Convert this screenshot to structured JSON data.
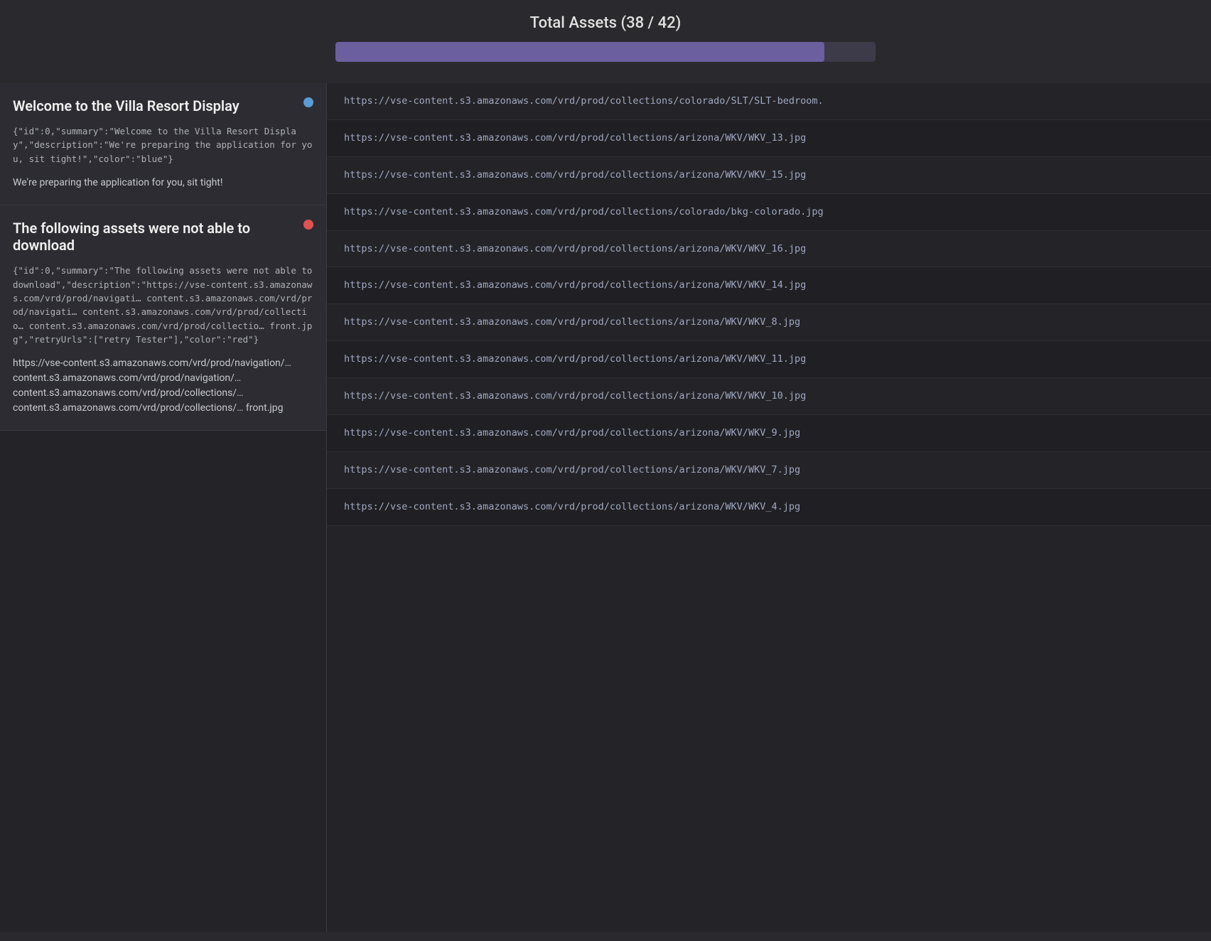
{
  "header": {
    "title": "Total Assets (38 / 42)",
    "progress_percent": 90.5,
    "progress_label": "38 / 42"
  },
  "cards": [
    {
      "id": "welcome-card",
      "title": "Welcome to the Villa Resort Display",
      "dot_color": "blue",
      "json_text": "{\"id\":0,\"summary\":\"Welcome to the Villa Resort Display\",\"description\":\"We're preparing the application for you, sit tight!\",\"color\":\"blue\"}",
      "description": "We're preparing the application for you, sit tight!"
    },
    {
      "id": "failed-assets-card",
      "title": "The following assets were not able to download",
      "dot_color": "red",
      "json_text": "{\"id\":0,\"summary\":\"The following assets were not able to download\",\"description\":\"https://vse-content.s3.amazonaws.com/vrd/prod/navigati… content.s3.amazonaws.com/vrd/prod/navigati… content.s3.amazonaws.com/vrd/prod/collectio… content.s3.amazonaws.com/vrd/prod/collectio… front.jpg\",\"retryUrls\":[\"retry Tester\"],\"color\":\"red\"}",
      "description": "https://vse-content.s3.amazonaws.com/vrd/prod/navigation/… content.s3.amazonaws.com/vrd/prod/navigation/… content.s3.amazonaws.com/vrd/prod/collections/… content.s3.amazonaws.com/vrd/prod/collections/… front.jpg"
    }
  ],
  "urls": [
    "https://vse-content.s3.amazonaws.com/vrd/prod/collections/colorado/SLT/SLT-bedroom.",
    "https://vse-content.s3.amazonaws.com/vrd/prod/collections/arizona/WKV/WKV_13.jpg",
    "https://vse-content.s3.amazonaws.com/vrd/prod/collections/arizona/WKV/WKV_15.jpg",
    "https://vse-content.s3.amazonaws.com/vrd/prod/collections/colorado/bkg-colorado.jpg",
    "https://vse-content.s3.amazonaws.com/vrd/prod/collections/arizona/WKV/WKV_16.jpg",
    "https://vse-content.s3.amazonaws.com/vrd/prod/collections/arizona/WKV/WKV_14.jpg",
    "https://vse-content.s3.amazonaws.com/vrd/prod/collections/arizona/WKV/WKV_8.jpg",
    "https://vse-content.s3.amazonaws.com/vrd/prod/collections/arizona/WKV/WKV_11.jpg",
    "https://vse-content.s3.amazonaws.com/vrd/prod/collections/arizona/WKV/WKV_10.jpg",
    "https://vse-content.s3.amazonaws.com/vrd/prod/collections/arizona/WKV/WKV_9.jpg",
    "https://vse-content.s3.amazonaws.com/vrd/prod/collections/arizona/WKV/WKV_7.jpg",
    "https://vse-content.s3.amazonaws.com/vrd/prod/collections/arizona/WKV/WKV_4.jpg"
  ]
}
